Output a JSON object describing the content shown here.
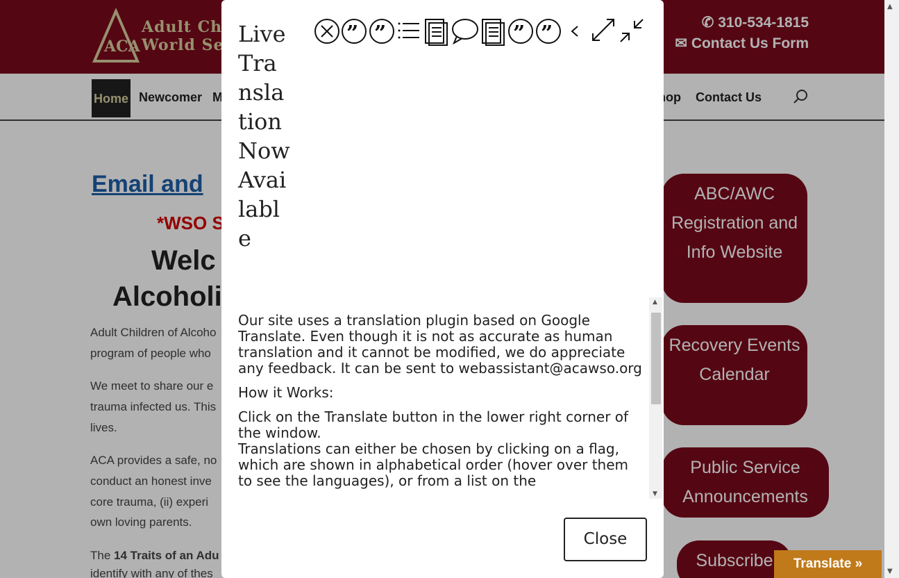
{
  "header": {
    "logo_line1": "Adult Children",
    "logo_line2": "World Service",
    "phone": "310-534-1815",
    "contact_form": "Contact Us Form"
  },
  "nav": {
    "home": "Home",
    "newcomer": "Newcomer",
    "m": "M",
    "shop": "hop",
    "contact": "Contact Us"
  },
  "main": {
    "email_heading": "Email and",
    "wso_line": "*WSO S",
    "welcome1": "Welc",
    "welcome2": "Alcoholi",
    "para1_line1": "Adult Children of Alcoho",
    "para1_line2": "program of people who",
    "para2_line1": "We meet to share our e",
    "para2_line2": "trauma infected us. This",
    "para2_line3": "lives.",
    "para3_line1": "ACA provides a safe, no",
    "para3_line2": "conduct an honest inve",
    "para3_line3": "core trauma, (ii) experi",
    "para3_line4": "own loving parents.",
    "para4_prefix": "The ",
    "para4_bold": "14 Traits of an Adu",
    "para4_line2": "identify with any of thes"
  },
  "sidebar": {
    "btn1": "ABC/AWC Registration and Info Website",
    "btn2": "Recovery Events Calendar",
    "btn3": "Public Service Announcements",
    "btn4": "Subscribe"
  },
  "translate_button": "Translate »",
  "modal": {
    "title": "Live Translation Now Available",
    "paragraph1": "Our site uses a translation plugin based on Google Translate. Even though it is not as accurate as human translation and it cannot be modified, we do appreciate any feedback. It can be sent to webassistant@acawso.org",
    "heading": "How it Works:",
    "paragraph2": "Click on the Translate button in the lower right corner of the window.",
    "paragraph3": "Translations can either be chosen by clicking on a flag, which are shown in alphabetical order (hover over them to see the languages), or from a list on the",
    "close_label": "Close",
    "toolbar_icons": [
      "close-circle-icon",
      "quote-icon",
      "quote-icon",
      "list-icon",
      "document-icon",
      "speech-bubble-icon",
      "document-icon",
      "quote-icon",
      "quote-icon",
      "chevron-left-icon",
      "expand-icon",
      "collapse-icon"
    ]
  },
  "colors": {
    "brand": "#7a0a1c",
    "link": "#1d5fa8",
    "alert": "#d40000",
    "translate": "#c07a1a"
  }
}
